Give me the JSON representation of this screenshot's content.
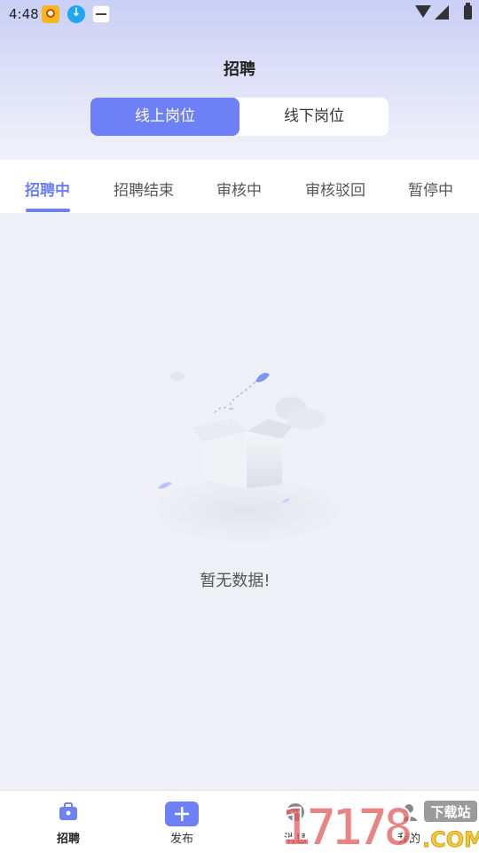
{
  "status_bar": {
    "time": "4:48"
  },
  "header": {
    "title": "招聘"
  },
  "segment": {
    "online_label": "线上岗位",
    "offline_label": "线下岗位"
  },
  "tabs": [
    {
      "label": "招聘中"
    },
    {
      "label": "招聘结束"
    },
    {
      "label": "审核中"
    },
    {
      "label": "审核驳回"
    },
    {
      "label": "暂停中"
    }
  ],
  "empty": {
    "message": "暂无数据!"
  },
  "bottom_nav": [
    {
      "label": "招聘",
      "icon": "briefcase-icon"
    },
    {
      "label": "发布",
      "icon": "plus-icon"
    },
    {
      "label": "消息",
      "icon": "message-icon"
    },
    {
      "label": "我的",
      "icon": "user-icon"
    }
  ],
  "watermark": {
    "number": "17178",
    "tag": "下载站",
    "suffix": ".COM"
  },
  "colors": {
    "accent": "#6d80f5",
    "background": "#eef0f5"
  }
}
